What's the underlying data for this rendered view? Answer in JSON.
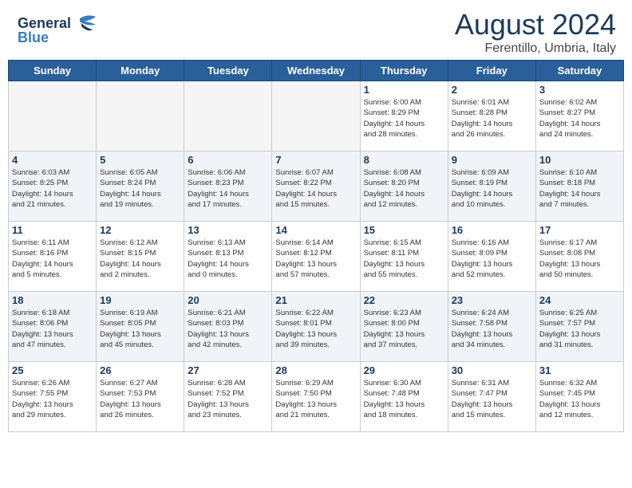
{
  "header": {
    "logo_line1": "General",
    "logo_line2": "Blue",
    "month_year": "August 2024",
    "location": "Ferentillo, Umbria, Italy"
  },
  "days_of_week": [
    "Sunday",
    "Monday",
    "Tuesday",
    "Wednesday",
    "Thursday",
    "Friday",
    "Saturday"
  ],
  "weeks": [
    [
      {
        "day": "",
        "info": "",
        "alt": false
      },
      {
        "day": "",
        "info": "",
        "alt": false
      },
      {
        "day": "",
        "info": "",
        "alt": false
      },
      {
        "day": "",
        "info": "",
        "alt": false
      },
      {
        "day": "1",
        "info": "Sunrise: 6:00 AM\nSunset: 8:29 PM\nDaylight: 14 hours\nand 28 minutes.",
        "alt": false
      },
      {
        "day": "2",
        "info": "Sunrise: 6:01 AM\nSunset: 8:28 PM\nDaylight: 14 hours\nand 26 minutes.",
        "alt": false
      },
      {
        "day": "3",
        "info": "Sunrise: 6:02 AM\nSunset: 8:27 PM\nDaylight: 14 hours\nand 24 minutes.",
        "alt": false
      }
    ],
    [
      {
        "day": "4",
        "info": "Sunrise: 6:03 AM\nSunset: 8:25 PM\nDaylight: 14 hours\nand 21 minutes.",
        "alt": true
      },
      {
        "day": "5",
        "info": "Sunrise: 6:05 AM\nSunset: 8:24 PM\nDaylight: 14 hours\nand 19 minutes.",
        "alt": true
      },
      {
        "day": "6",
        "info": "Sunrise: 6:06 AM\nSunset: 8:23 PM\nDaylight: 14 hours\nand 17 minutes.",
        "alt": true
      },
      {
        "day": "7",
        "info": "Sunrise: 6:07 AM\nSunset: 8:22 PM\nDaylight: 14 hours\nand 15 minutes.",
        "alt": true
      },
      {
        "day": "8",
        "info": "Sunrise: 6:08 AM\nSunset: 8:20 PM\nDaylight: 14 hours\nand 12 minutes.",
        "alt": true
      },
      {
        "day": "9",
        "info": "Sunrise: 6:09 AM\nSunset: 8:19 PM\nDaylight: 14 hours\nand 10 minutes.",
        "alt": true
      },
      {
        "day": "10",
        "info": "Sunrise: 6:10 AM\nSunset: 8:18 PM\nDaylight: 14 hours\nand 7 minutes.",
        "alt": true
      }
    ],
    [
      {
        "day": "11",
        "info": "Sunrise: 6:11 AM\nSunset: 8:16 PM\nDaylight: 14 hours\nand 5 minutes.",
        "alt": false
      },
      {
        "day": "12",
        "info": "Sunrise: 6:12 AM\nSunset: 8:15 PM\nDaylight: 14 hours\nand 2 minutes.",
        "alt": false
      },
      {
        "day": "13",
        "info": "Sunrise: 6:13 AM\nSunset: 8:13 PM\nDaylight: 14 hours\nand 0 minutes.",
        "alt": false
      },
      {
        "day": "14",
        "info": "Sunrise: 6:14 AM\nSunset: 8:12 PM\nDaylight: 13 hours\nand 57 minutes.",
        "alt": false
      },
      {
        "day": "15",
        "info": "Sunrise: 6:15 AM\nSunset: 8:11 PM\nDaylight: 13 hours\nand 55 minutes.",
        "alt": false
      },
      {
        "day": "16",
        "info": "Sunrise: 6:16 AM\nSunset: 8:09 PM\nDaylight: 13 hours\nand 52 minutes.",
        "alt": false
      },
      {
        "day": "17",
        "info": "Sunrise: 6:17 AM\nSunset: 8:08 PM\nDaylight: 13 hours\nand 50 minutes.",
        "alt": false
      }
    ],
    [
      {
        "day": "18",
        "info": "Sunrise: 6:18 AM\nSunset: 8:06 PM\nDaylight: 13 hours\nand 47 minutes.",
        "alt": true
      },
      {
        "day": "19",
        "info": "Sunrise: 6:19 AM\nSunset: 8:05 PM\nDaylight: 13 hours\nand 45 minutes.",
        "alt": true
      },
      {
        "day": "20",
        "info": "Sunrise: 6:21 AM\nSunset: 8:03 PM\nDaylight: 13 hours\nand 42 minutes.",
        "alt": true
      },
      {
        "day": "21",
        "info": "Sunrise: 6:22 AM\nSunset: 8:01 PM\nDaylight: 13 hours\nand 39 minutes.",
        "alt": true
      },
      {
        "day": "22",
        "info": "Sunrise: 6:23 AM\nSunset: 8:00 PM\nDaylight: 13 hours\nand 37 minutes.",
        "alt": true
      },
      {
        "day": "23",
        "info": "Sunrise: 6:24 AM\nSunset: 7:58 PM\nDaylight: 13 hours\nand 34 minutes.",
        "alt": true
      },
      {
        "day": "24",
        "info": "Sunrise: 6:25 AM\nSunset: 7:57 PM\nDaylight: 13 hours\nand 31 minutes.",
        "alt": true
      }
    ],
    [
      {
        "day": "25",
        "info": "Sunrise: 6:26 AM\nSunset: 7:55 PM\nDaylight: 13 hours\nand 29 minutes.",
        "alt": false
      },
      {
        "day": "26",
        "info": "Sunrise: 6:27 AM\nSunset: 7:53 PM\nDaylight: 13 hours\nand 26 minutes.",
        "alt": false
      },
      {
        "day": "27",
        "info": "Sunrise: 6:28 AM\nSunset: 7:52 PM\nDaylight: 13 hours\nand 23 minutes.",
        "alt": false
      },
      {
        "day": "28",
        "info": "Sunrise: 6:29 AM\nSunset: 7:50 PM\nDaylight: 13 hours\nand 21 minutes.",
        "alt": false
      },
      {
        "day": "29",
        "info": "Sunrise: 6:30 AM\nSunset: 7:48 PM\nDaylight: 13 hours\nand 18 minutes.",
        "alt": false
      },
      {
        "day": "30",
        "info": "Sunrise: 6:31 AM\nSunset: 7:47 PM\nDaylight: 13 hours\nand 15 minutes.",
        "alt": false
      },
      {
        "day": "31",
        "info": "Sunrise: 6:32 AM\nSunset: 7:45 PM\nDaylight: 13 hours\nand 12 minutes.",
        "alt": false
      }
    ]
  ]
}
